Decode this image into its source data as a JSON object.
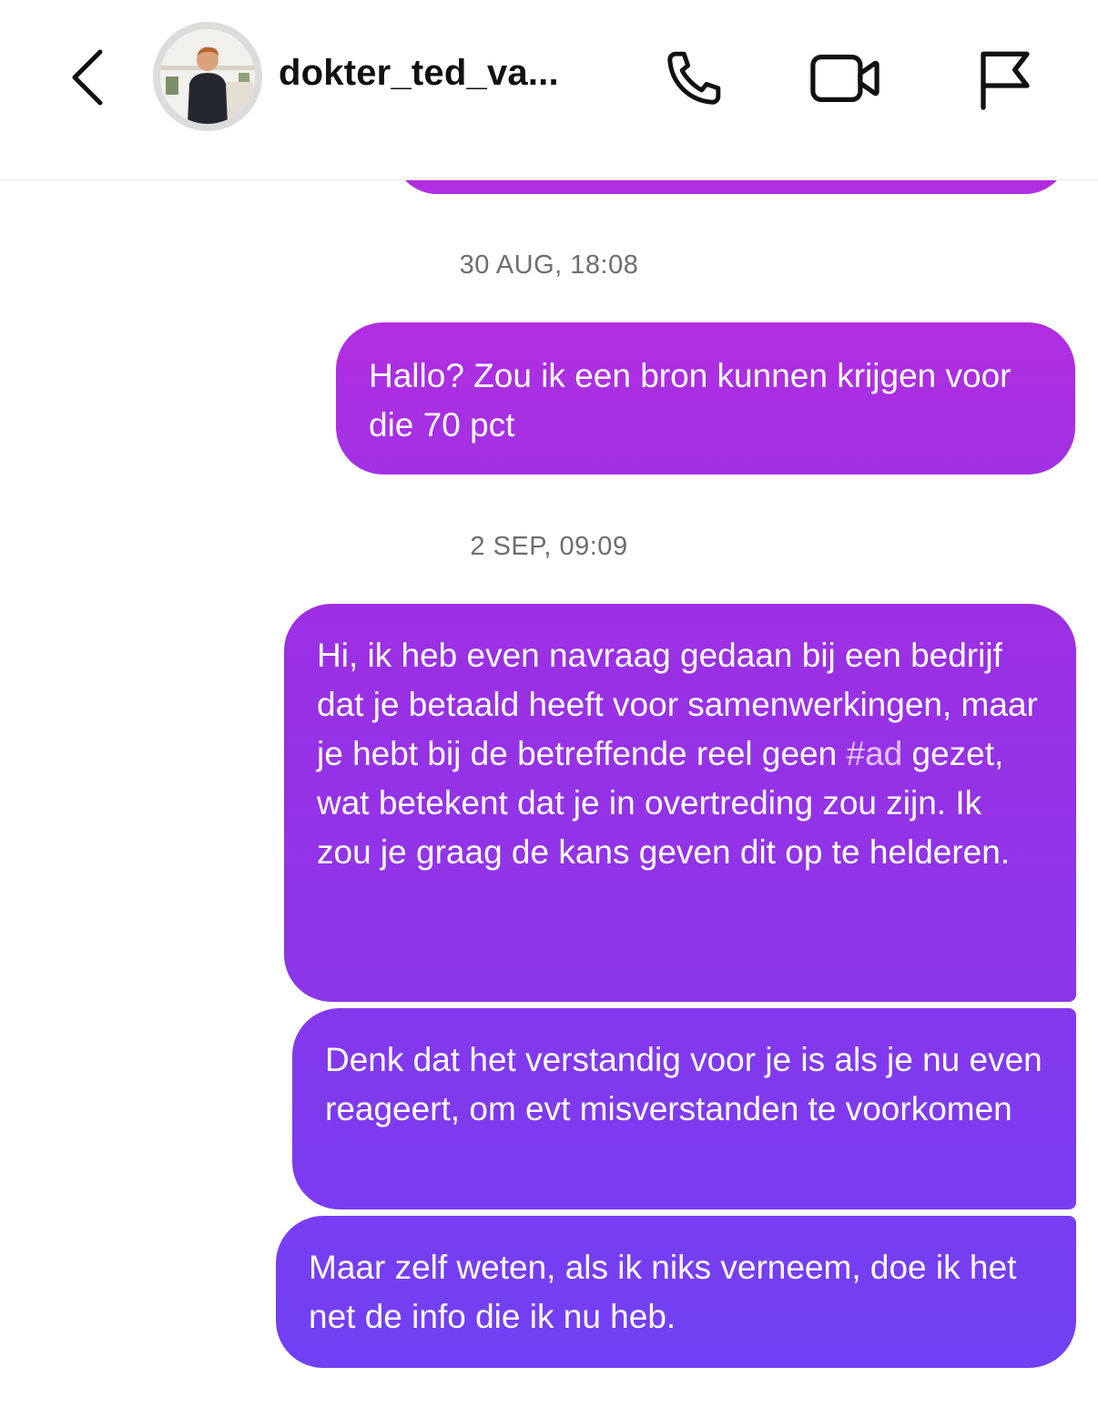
{
  "header": {
    "username": "dokter_ted_va...",
    "icons": {
      "back": "chevron-left-icon",
      "phone": "phone-icon",
      "video": "video-camera-icon",
      "flag": "flag-icon"
    }
  },
  "conversation": {
    "timestamps": [
      "30 AUG, 18:08",
      "2 SEP, 09:09"
    ],
    "messages": [
      {
        "text": "Hallo? Zou ik een bron kunnen krijgen voor die 70 pct"
      },
      {
        "text_before": "Hi, ik heb even navraag gedaan bij een bedrijf dat je betaald heeft voor samenwerkingen, maar je hebt bij de betreffende reel geen",
        "hashtag": "#ad",
        "text_after": "gezet, wat betekent dat je in overtreding zou zijn. Ik zou je graag de kans geven dit op te helderen."
      },
      {
        "text": "Denk dat het verstandig voor je is als je nu even reageert, om evt misverstanden te voorkomen"
      },
      {
        "text": "Maar zelf weten, als ik niks verneem, doe ik het net de info die ik nu heb."
      }
    ]
  },
  "colors": {
    "bubble_top": "#b12ee0",
    "bubble_bottom": "#7140f4",
    "timestamp": "#6e6e6e",
    "hashtag": "#e2c8ff"
  }
}
